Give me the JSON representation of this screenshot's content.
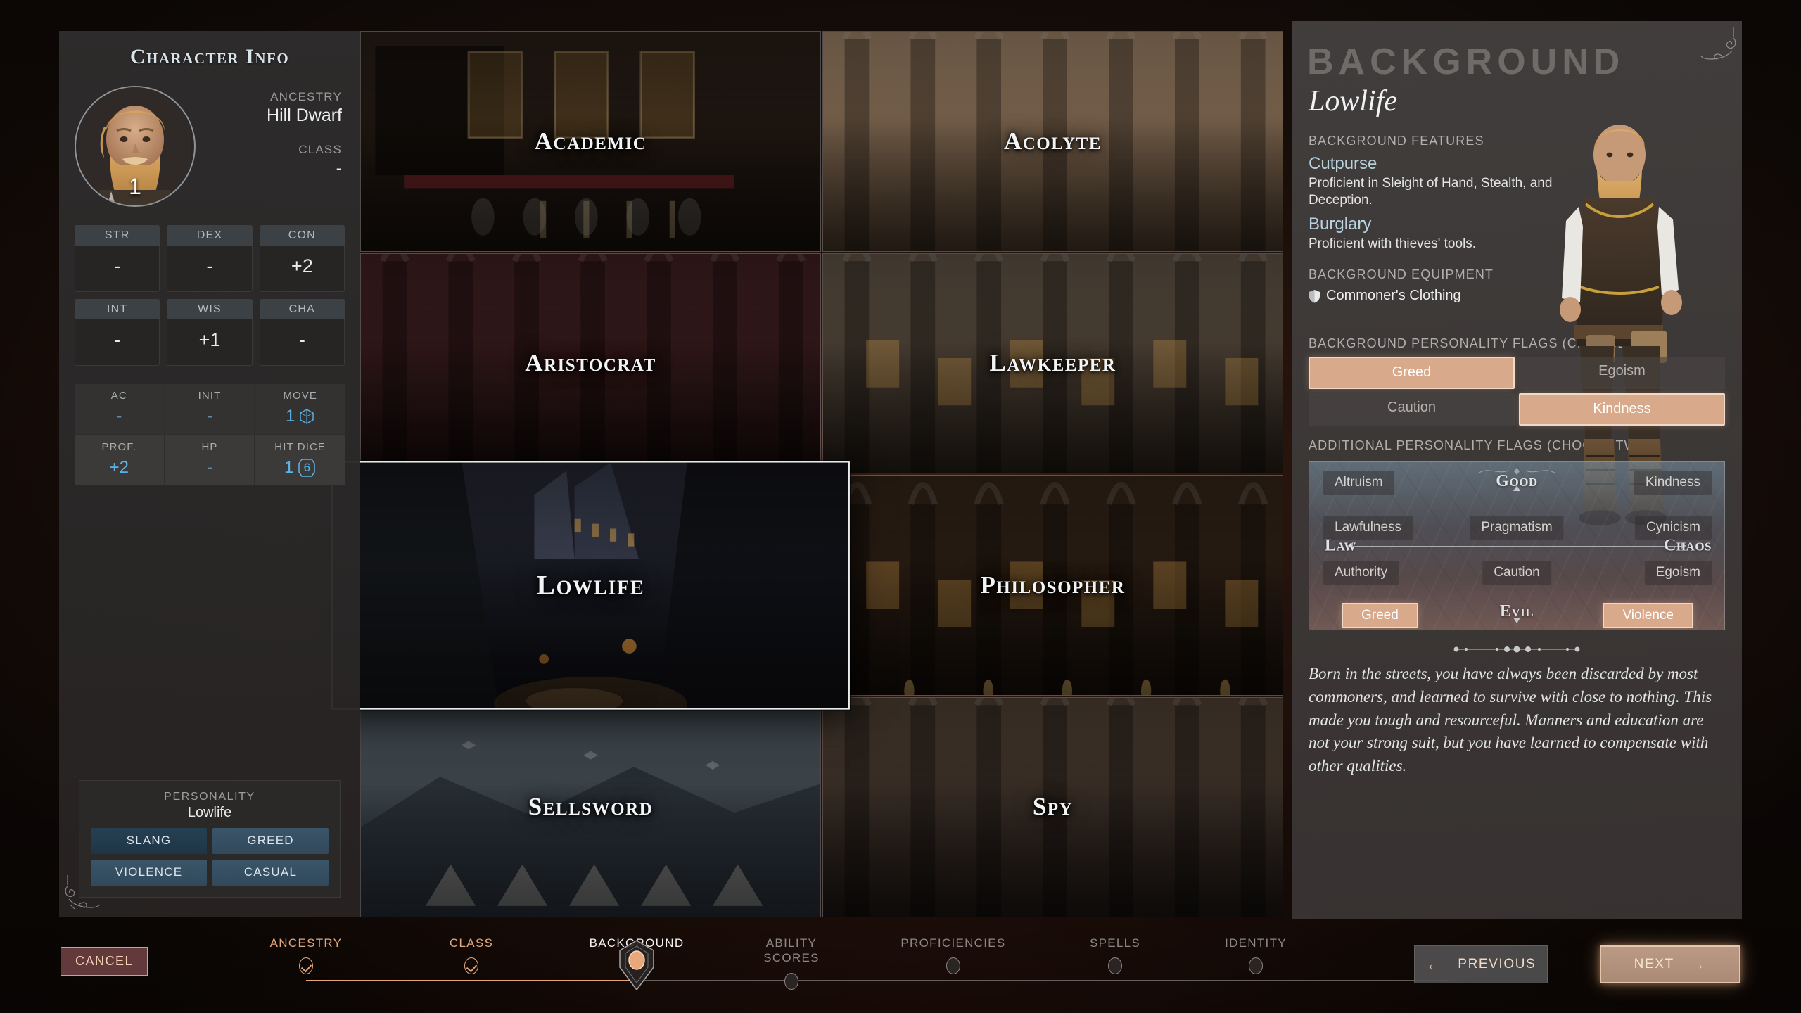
{
  "left_panel": {
    "title": "Character Info",
    "level": "1",
    "ancestry_label": "ANCESTRY",
    "ancestry_value": "Hill Dwarf",
    "class_label": "CLASS",
    "class_value": "-",
    "abilities": [
      {
        "key": "STR",
        "value": "-"
      },
      {
        "key": "DEX",
        "value": "-"
      },
      {
        "key": "CON",
        "value": "+2"
      },
      {
        "key": "INT",
        "value": "-"
      },
      {
        "key": "WIS",
        "value": "+1"
      },
      {
        "key": "CHA",
        "value": "-"
      }
    ],
    "combat": [
      {
        "key": "AC",
        "value": "-"
      },
      {
        "key": "INIT",
        "value": "-"
      },
      {
        "key": "MOVE",
        "value": "1",
        "icon": "d6-cube-icon"
      },
      {
        "key": "PROF.",
        "value": "+2"
      },
      {
        "key": "HP",
        "value": "-"
      },
      {
        "key": "HIT DICE",
        "value": "1",
        "icon": "d6-hexagon-icon",
        "icon_value": "6"
      }
    ],
    "personality": {
      "title": "PERSONALITY",
      "subtitle": "Lowlife",
      "tags": [
        "SLANG",
        "GREED",
        "VIOLENCE",
        "CASUAL"
      ]
    }
  },
  "backgrounds": [
    {
      "name": "Academic",
      "selected": false
    },
    {
      "name": "Acolyte",
      "selected": false
    },
    {
      "name": "Aristocrat",
      "selected": false
    },
    {
      "name": "Lawkeeper",
      "selected": false
    },
    {
      "name": "Lowlife",
      "selected": true
    },
    {
      "name": "Philosopher",
      "selected": false
    },
    {
      "name": "Sellsword",
      "selected": false
    },
    {
      "name": "Spy",
      "selected": false
    }
  ],
  "right_panel": {
    "ghost_title": "BACKGROUND",
    "name": "Lowlife",
    "features_label": "BACKGROUND FEATURES",
    "features": [
      {
        "name": "Cutpurse",
        "desc": "Proficient in Sleight of Hand, Stealth, and Deception."
      },
      {
        "name": "Burglary",
        "desc": "Proficient with thieves' tools."
      }
    ],
    "equipment_label": "BACKGROUND EQUIPMENT",
    "equipment": [
      {
        "name": "Commoner's Clothing",
        "icon": "shield-icon"
      }
    ],
    "bg_flags_label": "BACKGROUND PERSONALITY FLAGS (CHOOSE TWO)",
    "bg_flags": [
      {
        "label": "Greed",
        "selected": true
      },
      {
        "label": "Egoism",
        "selected": false
      },
      {
        "label": "Caution",
        "selected": false
      },
      {
        "label": "Kindness",
        "selected": true
      }
    ],
    "additional_flags_label": "ADDITIONAL PERSONALITY FLAGS (CHOOSE TWO)",
    "alignment": {
      "poles": {
        "good": "Good",
        "evil": "Evil",
        "law": "Law",
        "chaos": "Chaos"
      },
      "cells": [
        {
          "label": "Altruism",
          "row": 1,
          "col": "left",
          "selected": false
        },
        {
          "label": "Kindness",
          "row": 1,
          "col": "right",
          "selected": false
        },
        {
          "label": "Lawfulness",
          "row": 2,
          "col": "left",
          "selected": false
        },
        {
          "label": "Pragmatism",
          "row": 2,
          "col": "middle",
          "selected": false
        },
        {
          "label": "Cynicism",
          "row": 2,
          "col": "right",
          "selected": false
        },
        {
          "label": "Authority",
          "row": 3,
          "col": "left",
          "selected": false
        },
        {
          "label": "Caution",
          "row": 3,
          "col": "middle",
          "selected": false
        },
        {
          "label": "Egoism",
          "row": 3,
          "col": "right",
          "selected": false
        },
        {
          "label": "Greed",
          "row": 4,
          "col": "left",
          "selected": true
        },
        {
          "label": "Violence",
          "row": 4,
          "col": "right",
          "selected": true
        }
      ]
    },
    "blurb": "Born in the streets, you have always been discarded by most commoners, and learned to survive with close to nothing. This made you tough and resourceful. Manners and education are not your strong suit, but you have learned to compensate with other qualities."
  },
  "footer": {
    "cancel_label": "CANCEL",
    "previous_label": "PREVIOUS",
    "next_label": "NEXT",
    "steps": [
      {
        "label": "ANCESTRY",
        "state": "done"
      },
      {
        "label": "CLASS",
        "state": "done"
      },
      {
        "label": "BACKGROUND",
        "state": "current"
      },
      {
        "label": "ABILITY\nSCORES",
        "state": "todo"
      },
      {
        "label": "PROFICIENCIES",
        "state": "todo"
      },
      {
        "label": "SPELLS",
        "state": "todo"
      },
      {
        "label": "IDENTITY",
        "state": "todo"
      }
    ]
  },
  "colors": {
    "accent": "#e2a77d",
    "selected_flag": "#d8a98a",
    "stat_blue": "#5cb3e8",
    "feature_blue": "#b8d2de",
    "cancel_red": "#824c4e"
  }
}
